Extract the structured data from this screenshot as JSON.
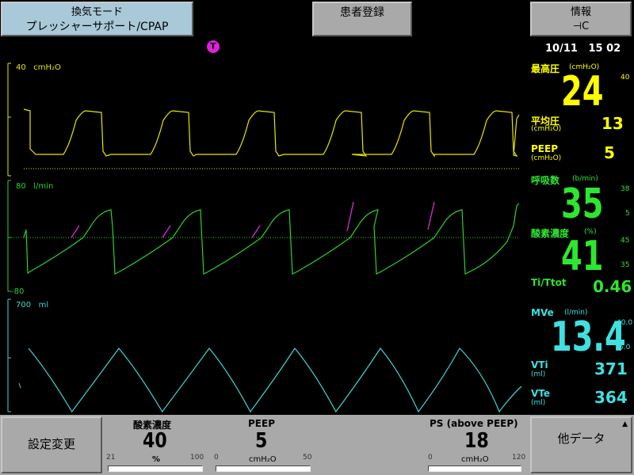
{
  "header": {
    "mode_button": {
      "title": "換気モード",
      "value": "プレッシャーサポート/CPAP"
    },
    "patient_button": "患者登録",
    "info_button": {
      "title": "情報",
      "icon": "plug-icon",
      "glyph": "-Ç"
    },
    "trigger_icon": "T",
    "date": "10/11",
    "time": "15 02"
  },
  "waveforms": {
    "pressure": {
      "scale_top": "40",
      "unit": "cmH₂O",
      "color": "#e6e600"
    },
    "flow": {
      "scale_top": "80",
      "unit": "l/min",
      "scale_bottom": "-80",
      "color": "#2ccf2c",
      "accent": "#d92bd9"
    },
    "volume": {
      "scale_top": "700",
      "unit": "ml",
      "color": "#3fd6d0"
    }
  },
  "readouts": {
    "peak": {
      "label": "最高圧",
      "unit": "(cmH₂O)",
      "value": "24",
      "limit": "40"
    },
    "mean": {
      "label": "平均圧",
      "unit": "(cmH₂O)",
      "value": "13"
    },
    "peep": {
      "label": "PEEP",
      "unit": "(cmH₂O)",
      "value": "5"
    },
    "resp_rate": {
      "label": "呼吸数",
      "unit": "(b/min)",
      "value": "35",
      "limit_high": "38",
      "limit_low": "5"
    },
    "o2": {
      "label": "酸素濃度",
      "unit": "(%)",
      "value": "41",
      "limit_high": "45",
      "limit_low": "35"
    },
    "ti_ttot": {
      "label": "Ti/Ttot",
      "value": "0.46"
    },
    "mve": {
      "label": "MVe",
      "unit": "(l/min)",
      "value": "13.4",
      "limit_high": "40.0",
      "limit_low": "5.0"
    },
    "vti": {
      "label": "VTi",
      "unit": "(ml)",
      "value": "371"
    },
    "vte": {
      "label": "VTe",
      "unit": "(ml)",
      "value": "364"
    }
  },
  "bottom": {
    "settings_button": "設定変更",
    "other_button": "他データ",
    "o2_setting": {
      "title": "酸素濃度",
      "value": "40",
      "unit": "%",
      "min": "21",
      "max": "100",
      "fraction": 0.24
    },
    "peep_setting": {
      "title": "PEEP",
      "value": "5",
      "unit": "cmH₂O",
      "min": "0",
      "max": "50",
      "fraction": 0.1
    },
    "ps_setting": {
      "title": "PS (above PEEP)",
      "value": "18",
      "unit": "cmH₂O",
      "min": "0",
      "max": "120",
      "fraction": 0.15
    }
  },
  "colors": {
    "button_face": "#a9c9d8",
    "button_gray": "#a9a9a9",
    "yellow": "#ffff00",
    "green": "#2ee62e",
    "cyan": "#3fe0e0",
    "magenta": "#e020e0"
  }
}
